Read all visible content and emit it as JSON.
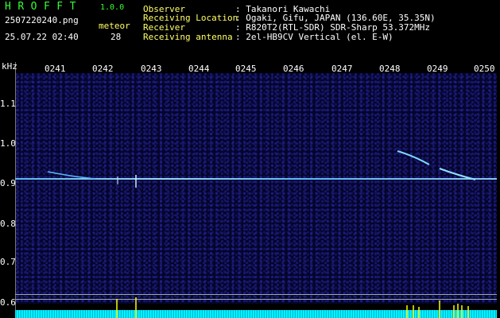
{
  "header": {
    "logo": "HROFFT",
    "version": "1.0.0",
    "filename": "2507220240.png",
    "timestamp": "25.07.22 02:40",
    "type_label": "meteor",
    "count": "28",
    "info": [
      {
        "label": "Observer",
        "value": ": Takanori Kawachi"
      },
      {
        "label": "Receiving Location",
        "value": ": Ogaki, Gifu, JAPAN (136.60E, 35.35N)"
      },
      {
        "label": "Receiver",
        "value": ": R820T2(RTL-SDR) SDR-Sharp 53.372MHz"
      },
      {
        "label": "Receiving antenna",
        "value": ": 2el-HB9CV Vertical (el. E-W)"
      }
    ]
  },
  "axes": {
    "y_unit": "kHz",
    "y_ticks": [
      "1.1",
      "1.0",
      "0.9",
      "0.8",
      "0.7",
      "0.6"
    ],
    "x_ticks": [
      "0241",
      "0242",
      "0243",
      "0244",
      "0245",
      "0246",
      "0247",
      "0248",
      "0249",
      "0250"
    ]
  },
  "colors": {
    "accent": "#33ff33",
    "highlight": "#ffff66",
    "carrier": "#66ccff",
    "baseline": "#00e5ff"
  }
}
